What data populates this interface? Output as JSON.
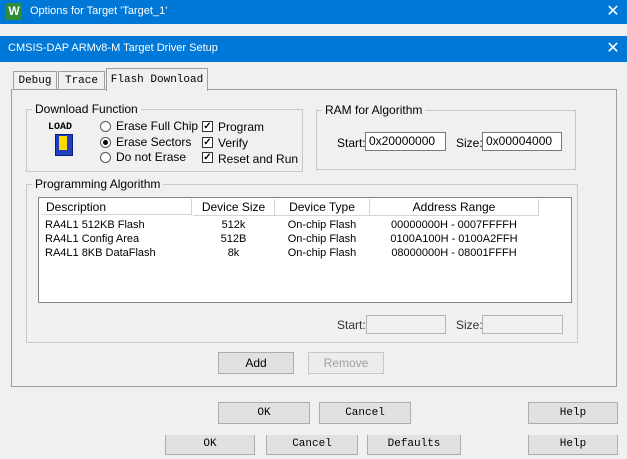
{
  "outer": {
    "logo": "W",
    "title": "Options for Target 'Target_1'",
    "close": "✕",
    "buttons": {
      "ok": "OK",
      "cancel": "Cancel",
      "defaults": "Defaults",
      "help": "Help"
    }
  },
  "dialog": {
    "title": "CMSIS-DAP ARMv8-M Target Driver Setup",
    "close": "✕",
    "tabs": [
      "Debug",
      "Trace",
      "Flash Download"
    ],
    "active_tab": "Flash Download",
    "buttons": {
      "ok": "OK",
      "cancel": "Cancel",
      "help": "Help"
    }
  },
  "download_function": {
    "label": "Download Function",
    "icon_text": "LOAD",
    "radios": [
      {
        "label": "Erase Full Chip",
        "selected": false
      },
      {
        "label": "Erase Sectors",
        "selected": true
      },
      {
        "label": "Do not Erase",
        "selected": false
      }
    ],
    "checks": [
      {
        "label": "Program",
        "checked": true
      },
      {
        "label": "Verify",
        "checked": true
      },
      {
        "label": "Reset and Run",
        "checked": true
      }
    ],
    "check_mark": "✓"
  },
  "ram": {
    "label": "RAM for Algorithm",
    "start_label": "Start:",
    "start_value": "0x20000000",
    "size_label": "Size:",
    "size_value": "0x00004000"
  },
  "programming": {
    "label": "Programming Algorithm",
    "columns": [
      "Description",
      "Device Size",
      "Device Type",
      "Address Range"
    ],
    "rows": [
      [
        "RA4L1 512KB Flash",
        "512k",
        "On-chip Flash",
        "00000000H - 0007FFFFH"
      ],
      [
        "RA4L1 Config Area",
        "512B",
        "On-chip Flash",
        "0100A100H - 0100A2FFH"
      ],
      [
        "RA4L1 8KB DataFlash",
        "8k",
        "On-chip Flash",
        "08000000H - 08001FFFH"
      ]
    ],
    "start_label": "Start:",
    "start_value": "",
    "size_label": "Size:",
    "size_value": "",
    "add_label": "Add",
    "remove_label": "Remove"
  }
}
